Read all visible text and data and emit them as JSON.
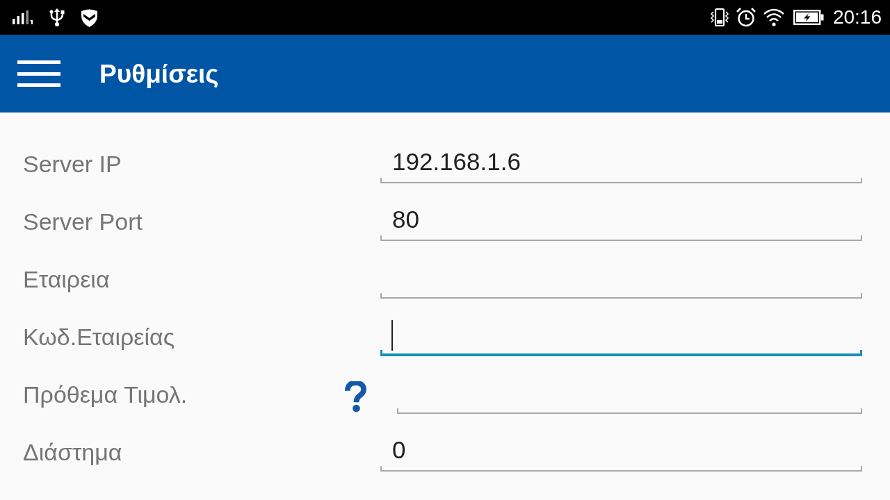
{
  "status_bar": {
    "time": "20:16"
  },
  "app_bar": {
    "title": "Ρυθμίσεις"
  },
  "fields": [
    {
      "label": "Server IP",
      "value": "192.168.1.6",
      "focused": false,
      "help": false
    },
    {
      "label": "Server Port",
      "value": "80",
      "focused": false,
      "help": false
    },
    {
      "label": "Εταιρεια",
      "focused": false,
      "help": false
    },
    {
      "label": "Κωδ.Εταιρείας",
      "focused": true,
      "help": false
    },
    {
      "label": "Πρόθεμα Τιμολ.",
      "focused": false,
      "help": true
    },
    {
      "label": "Διάστημα",
      "value": "0",
      "focused": false,
      "help": false
    }
  ]
}
